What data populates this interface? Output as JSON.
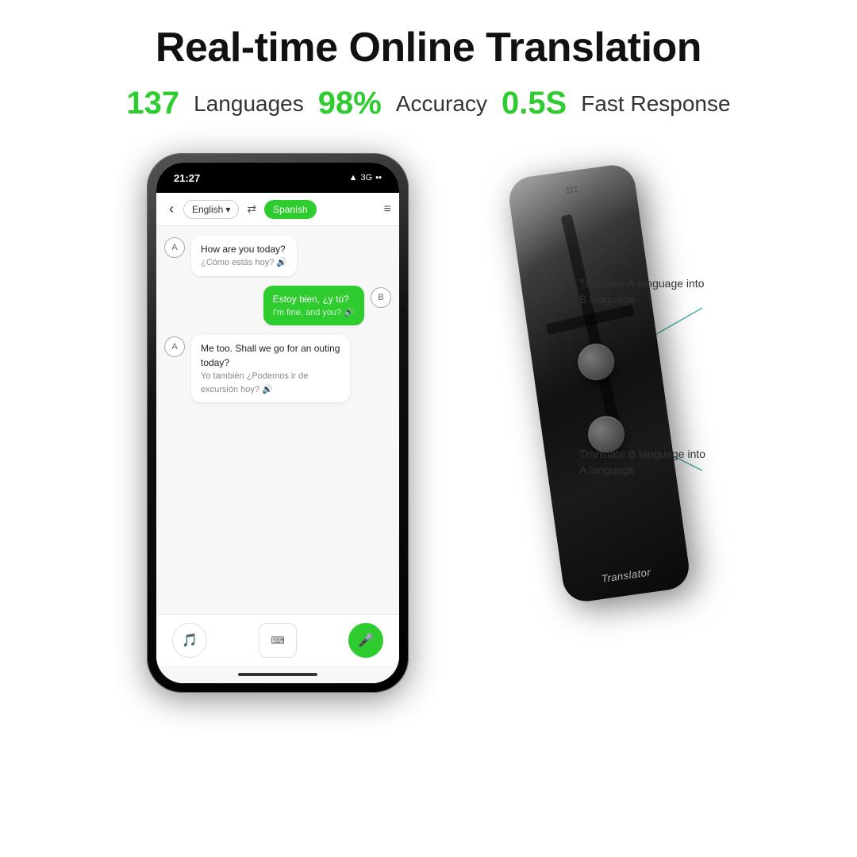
{
  "page": {
    "background": "#ffffff"
  },
  "header": {
    "title": "Real-time Online Translation"
  },
  "stats": [
    {
      "number": "137",
      "label": "Languages"
    },
    {
      "number": "98%",
      "label": "Accuracy"
    },
    {
      "number": "0.5S",
      "label": "Fast Response"
    }
  ],
  "phone": {
    "status_time": "21:27",
    "status_signal": "▲ 3G",
    "lang_a": "English",
    "lang_b": "Spanish",
    "messages": [
      {
        "side": "left",
        "avatar": "A",
        "text": "How are you today?",
        "translation": "¿Cómo estás hoy?",
        "has_sound": true,
        "green": false
      },
      {
        "side": "right",
        "avatar": "B",
        "text": "Estoy bien, ¿y tú?",
        "translation": "I'm fine, and you?",
        "has_sound": true,
        "green": true
      },
      {
        "side": "left",
        "avatar": "A",
        "text": "Me too. Shall we go for an outing today?",
        "translation": "Yo también ¿Podemos ir de excursión hoy?",
        "has_sound": true,
        "green": false
      }
    ]
  },
  "device": {
    "label": "Translator",
    "annotation_a": {
      "text": "Translate A language into B language"
    },
    "annotation_b": {
      "text": "Translate B language into A language"
    }
  }
}
